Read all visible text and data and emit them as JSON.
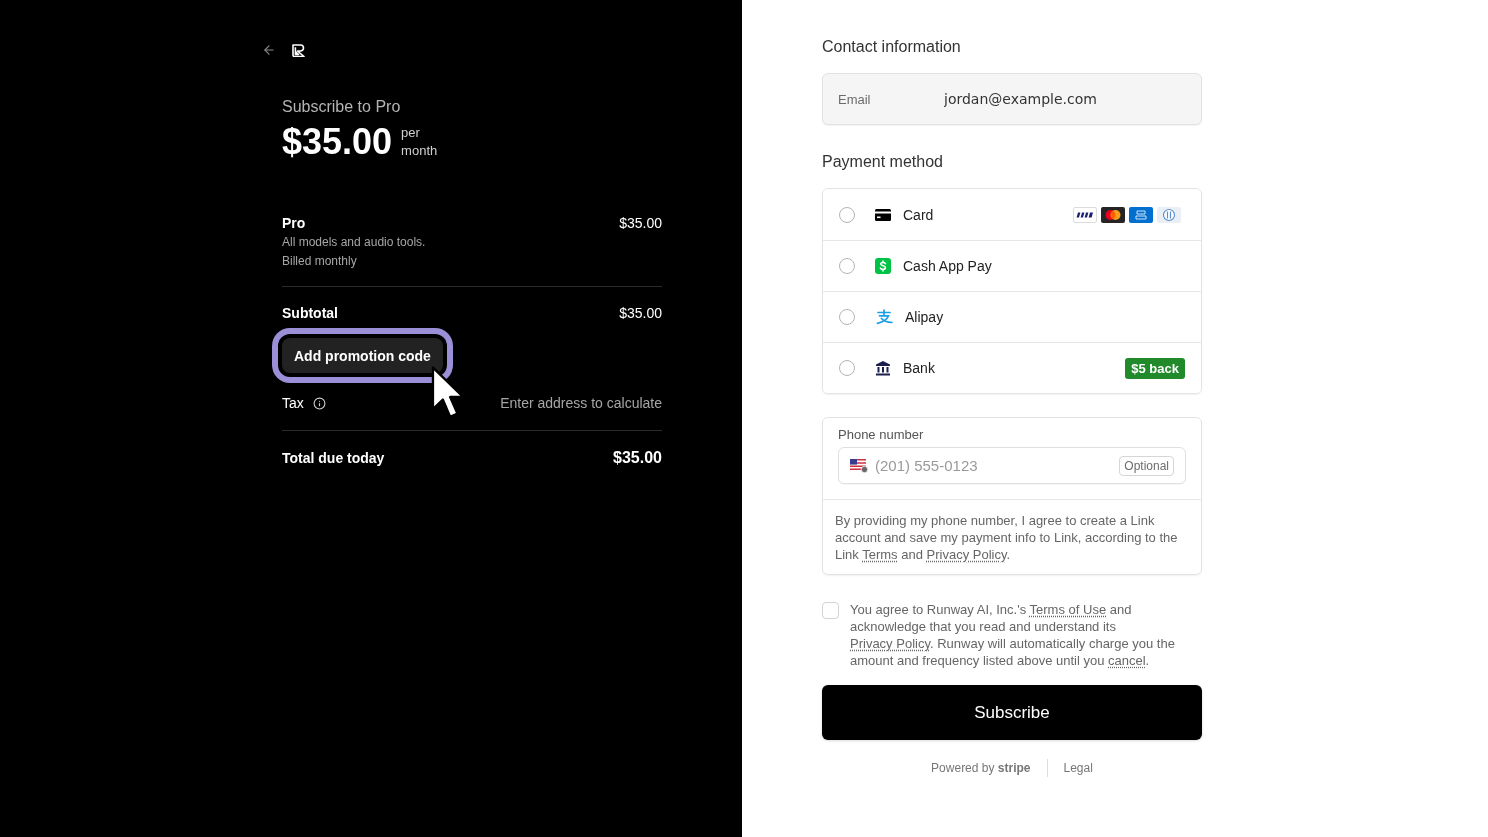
{
  "summary": {
    "title": "Subscribe to Pro",
    "price": "$35.00",
    "period": "per month"
  },
  "line_items": [
    {
      "name": "Pro",
      "description": "All models and audio tools.",
      "billing": "Billed monthly",
      "amount": "$35.00"
    }
  ],
  "subtotal": {
    "label": "Subtotal",
    "amount": "$35.00"
  },
  "promo_button": {
    "label": "Add promotion code",
    "focused": true
  },
  "tax": {
    "label": "Tax",
    "value": "Enter address to calculate"
  },
  "total": {
    "label": "Total due today",
    "amount": "$35.00"
  },
  "contact": {
    "heading": "Contact information",
    "email": {
      "label": "Email",
      "value": "jordan@example.com"
    }
  },
  "payment": {
    "heading": "Payment method",
    "methods": [
      {
        "kind": "card",
        "label": "Card",
        "selected": false
      },
      {
        "kind": "cashapp",
        "label": "Cash App Pay",
        "selected": false
      },
      {
        "kind": "alipay",
        "label": "Alipay",
        "selected": false
      },
      {
        "kind": "bank",
        "label": "Bank",
        "badge": "$5 back",
        "selected": false
      }
    ]
  },
  "phone": {
    "label": "Phone number",
    "placeholder": "(201) 555-0123",
    "badge": "Optional",
    "notice": [
      {
        "kind": "text",
        "text": "By providing my phone number, I agree to create a Link account and save my payment info to Link, according to the Link "
      },
      {
        "kind": "link",
        "text": "Terms"
      },
      {
        "kind": "text",
        "text": " and "
      },
      {
        "kind": "link",
        "text": "Privacy Policy"
      },
      {
        "kind": "text",
        "text": "."
      }
    ]
  },
  "consent": {
    "checked": false,
    "parts": [
      {
        "kind": "text",
        "text": "You agree to Runway AI, Inc.'s "
      },
      {
        "kind": "link",
        "text": "Terms of Use"
      },
      {
        "kind": "text",
        "text": " and acknowledge that you read and understand its "
      },
      {
        "kind": "link",
        "text": "Privacy Policy"
      },
      {
        "kind": "text",
        "text": ". Runway will automatically charge you the amount and frequency listed above until you "
      },
      {
        "kind": "link",
        "text": "cancel"
      },
      {
        "kind": "text",
        "text": "."
      }
    ]
  },
  "subscribe_button": {
    "label": "Subscribe"
  },
  "footer": {
    "powered_by": "Powered by **stripe**",
    "links": [
      "Legal"
    ]
  }
}
